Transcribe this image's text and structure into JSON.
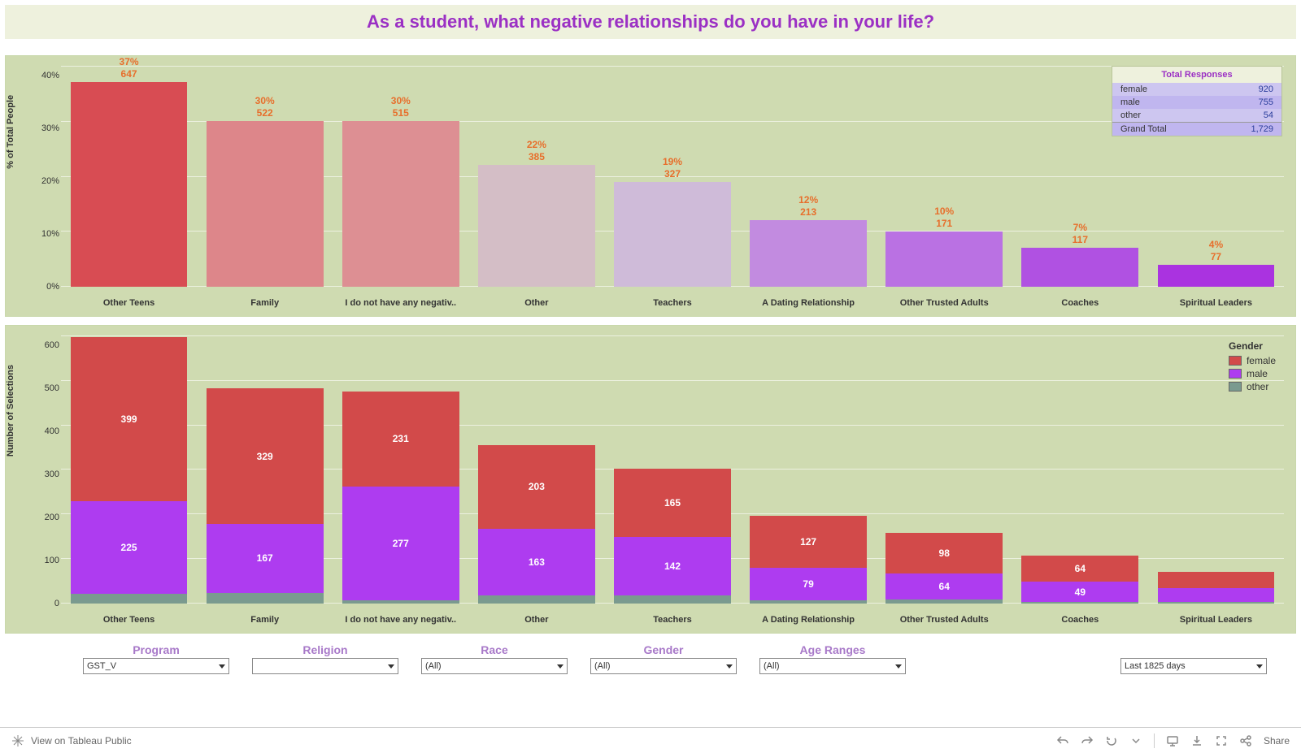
{
  "title": "As a student, what negative relationships do you have in your life?",
  "chart_data": {
    "percent_chart": {
      "type": "bar",
      "ylabel": "% of Total People",
      "ylim": [
        0,
        40
      ],
      "yticks": [
        "40%",
        "30%",
        "20%",
        "10%",
        "0%"
      ],
      "categories": [
        "Other Teens",
        "Family",
        "I do not have any negativ..",
        "Other",
        "Teachers",
        "A Dating Relationship",
        "Other Trusted Adults",
        "Coaches",
        "Spiritual Leaders"
      ],
      "percents": [
        37,
        30,
        30,
        22,
        19,
        12,
        10,
        7,
        4
      ],
      "counts": [
        647,
        522,
        515,
        385,
        327,
        213,
        171,
        117,
        77
      ],
      "bar_colors": [
        "#d84c53",
        "#dd868a",
        "#dd8f93",
        "#d4bec6",
        "#cfbbd9",
        "#c28be0",
        "#ba71e3",
        "#b051e2",
        "#aa33e0"
      ]
    },
    "stacked_chart": {
      "type": "bar",
      "ylabel": "Number of Selections",
      "ylim": [
        0,
        650
      ],
      "yticks": [
        "600",
        "500",
        "400",
        "300",
        "200",
        "100",
        "0"
      ],
      "categories": [
        "Other Teens",
        "Family",
        "I do not have any negativ..",
        "Other",
        "Teachers",
        "A Dating Relationship",
        "Other Trusted Adults",
        "Coaches",
        "Spiritual Leaders"
      ],
      "series": [
        {
          "name": "other",
          "color": "#7a9a8f",
          "values": [
            23,
            26,
            7,
            19,
            20,
            7,
            9,
            4,
            3
          ]
        },
        {
          "name": "male",
          "color": "#ae3cf0",
          "values": [
            225,
            167,
            277,
            163,
            142,
            79,
            64,
            49,
            34
          ]
        },
        {
          "name": "female",
          "color": "#d24a4a",
          "values": [
            399,
            329,
            231,
            203,
            165,
            127,
            98,
            64,
            40
          ]
        }
      ],
      "show_labels_over": 45
    }
  },
  "totals": {
    "header": "Total Responses",
    "rows": [
      {
        "k": "female",
        "v": "920"
      },
      {
        "k": "male",
        "v": "755"
      },
      {
        "k": "other",
        "v": "54"
      },
      {
        "k": "Grand Total",
        "v": "1,729"
      }
    ]
  },
  "legend": {
    "header": "Gender",
    "items": [
      {
        "label": "female",
        "color": "#d24a4a"
      },
      {
        "label": "male",
        "color": "#ae3cf0"
      },
      {
        "label": "other",
        "color": "#7a9a8f"
      }
    ]
  },
  "filters": [
    {
      "label": "Program",
      "value": "GST_V"
    },
    {
      "label": "Religion",
      "value": ""
    },
    {
      "label": "Race",
      "value": "(All)"
    },
    {
      "label": "Gender",
      "value": "(All)"
    },
    {
      "label": "Age Ranges",
      "value": "(All)"
    }
  ],
  "date_filter": "Last 1825 days",
  "footer": {
    "view_label": "View on Tableau Public",
    "share": "Share"
  }
}
